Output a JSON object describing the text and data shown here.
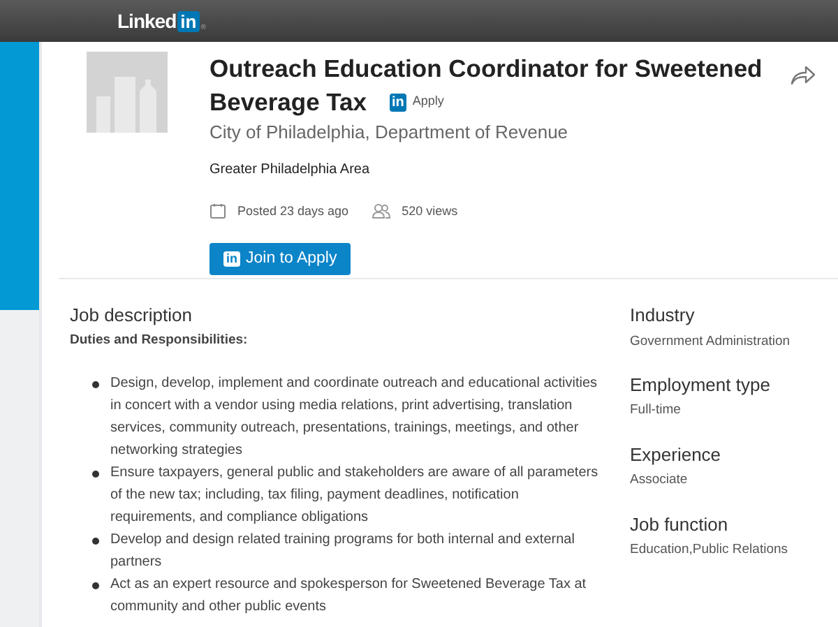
{
  "topbar": {
    "logo_text": "Linked",
    "logo_badge": "in",
    "logo_mark": "®"
  },
  "job": {
    "title_lines": [
      "Outreach Education Coordinator for Sweetened",
      "Beverage Tax"
    ],
    "apply_badge": {
      "icon_text": "in",
      "label": "Apply"
    },
    "company": "City of Philadelphia, Department of Revenue",
    "location": "Greater Philadelphia Area",
    "posted": "Posted 23 days ago",
    "views": "520 views",
    "button": {
      "icon_text": "in",
      "label": "Join to Apply"
    }
  },
  "description": {
    "heading": "Job description",
    "subheading": "Duties and Responsibilities:",
    "items": [
      "Design, develop, implement and coordinate outreach and educational activities in concert with a vendor using media relations, print advertising, translation services, community outreach, presentations, trainings, meetings, and other networking strategies",
      "Ensure taxpayers, general public and stakeholders are aware of all parameters of the new tax; including, tax filing, payment deadlines, notification requirements, and compliance obligations",
      "Develop and design related training programs for both internal and external partners",
      "Act as an expert resource and spokesperson for Sweetened Beverage Tax at community and other public events"
    ]
  },
  "criteria": [
    {
      "label": "Industry",
      "value": "Government Administration"
    },
    {
      "label": "Employment type",
      "value": "Full-time"
    },
    {
      "label": "Experience",
      "value": "Associate"
    },
    {
      "label": "Job function",
      "value": "Education,Public Relations"
    }
  ]
}
